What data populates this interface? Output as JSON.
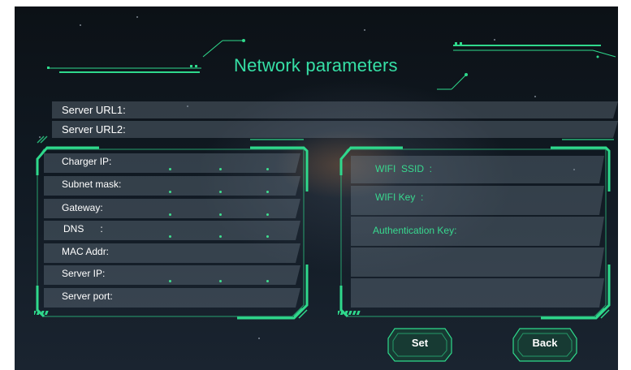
{
  "title": "Network parameters",
  "top_fields": [
    {
      "label": "Server URL1:"
    },
    {
      "label": "Server URL2:"
    }
  ],
  "left_panel": {
    "fields": [
      {
        "label": "Charger IP:"
      },
      {
        "label": "Subnet mask:"
      },
      {
        "label": "Gateway:"
      },
      {
        "label": "DNS      :"
      },
      {
        "label": "MAC Addr:"
      },
      {
        "label": "Server IP:"
      },
      {
        "label": "Server port:"
      }
    ]
  },
  "right_panel": {
    "fields": [
      {
        "label": "WIFI  SSID  :"
      },
      {
        "label": "WIFI Key  :"
      },
      {
        "label": "Authentication Key:"
      }
    ]
  },
  "buttons": {
    "set_label": "Set",
    "back_label": "Back"
  },
  "colors": {
    "accent": "#36e0a6",
    "frame": "#2fd98c",
    "field_bg": "#5f6c79",
    "background": "#101922"
  }
}
